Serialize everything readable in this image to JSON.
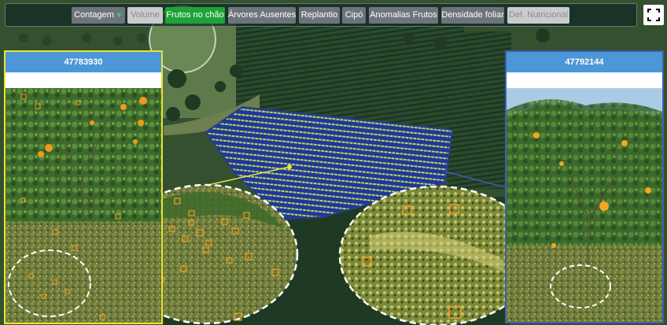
{
  "toolbar": {
    "buttons": [
      {
        "label": "Contagem",
        "state": "normal",
        "has_dropdown": true
      },
      {
        "label": "Volume",
        "state": "disabled"
      },
      {
        "label": "Frutos no chão",
        "state": "active"
      },
      {
        "label": "Árvores Ausentes",
        "state": "normal"
      },
      {
        "label": "Replantio",
        "state": "normal"
      },
      {
        "label": "Cipó",
        "state": "normal"
      },
      {
        "label": "Anomalias Frutos",
        "state": "normal"
      },
      {
        "label": "Densidade foliar",
        "state": "normal"
      },
      {
        "label": "Def. Nutricional",
        "state": "disabled"
      }
    ],
    "dropdown_icon": "chevron-down-icon"
  },
  "fullscreen": {
    "icon": "fullscreen-icon"
  },
  "photos": {
    "left": {
      "id": "47783930",
      "border_color": "#e9e334"
    },
    "right": {
      "id": "47792144",
      "border_color": "#3d5fb0"
    }
  },
  "colors": {
    "active_button": "#1da338",
    "button": "#6e747b",
    "disabled_button": "#c9cbce",
    "panel_header": "#4d97d8",
    "heatmap_low": "#1f2f8f",
    "heatmap_high": "#e8e83a",
    "detection_box": "#f0a020"
  }
}
